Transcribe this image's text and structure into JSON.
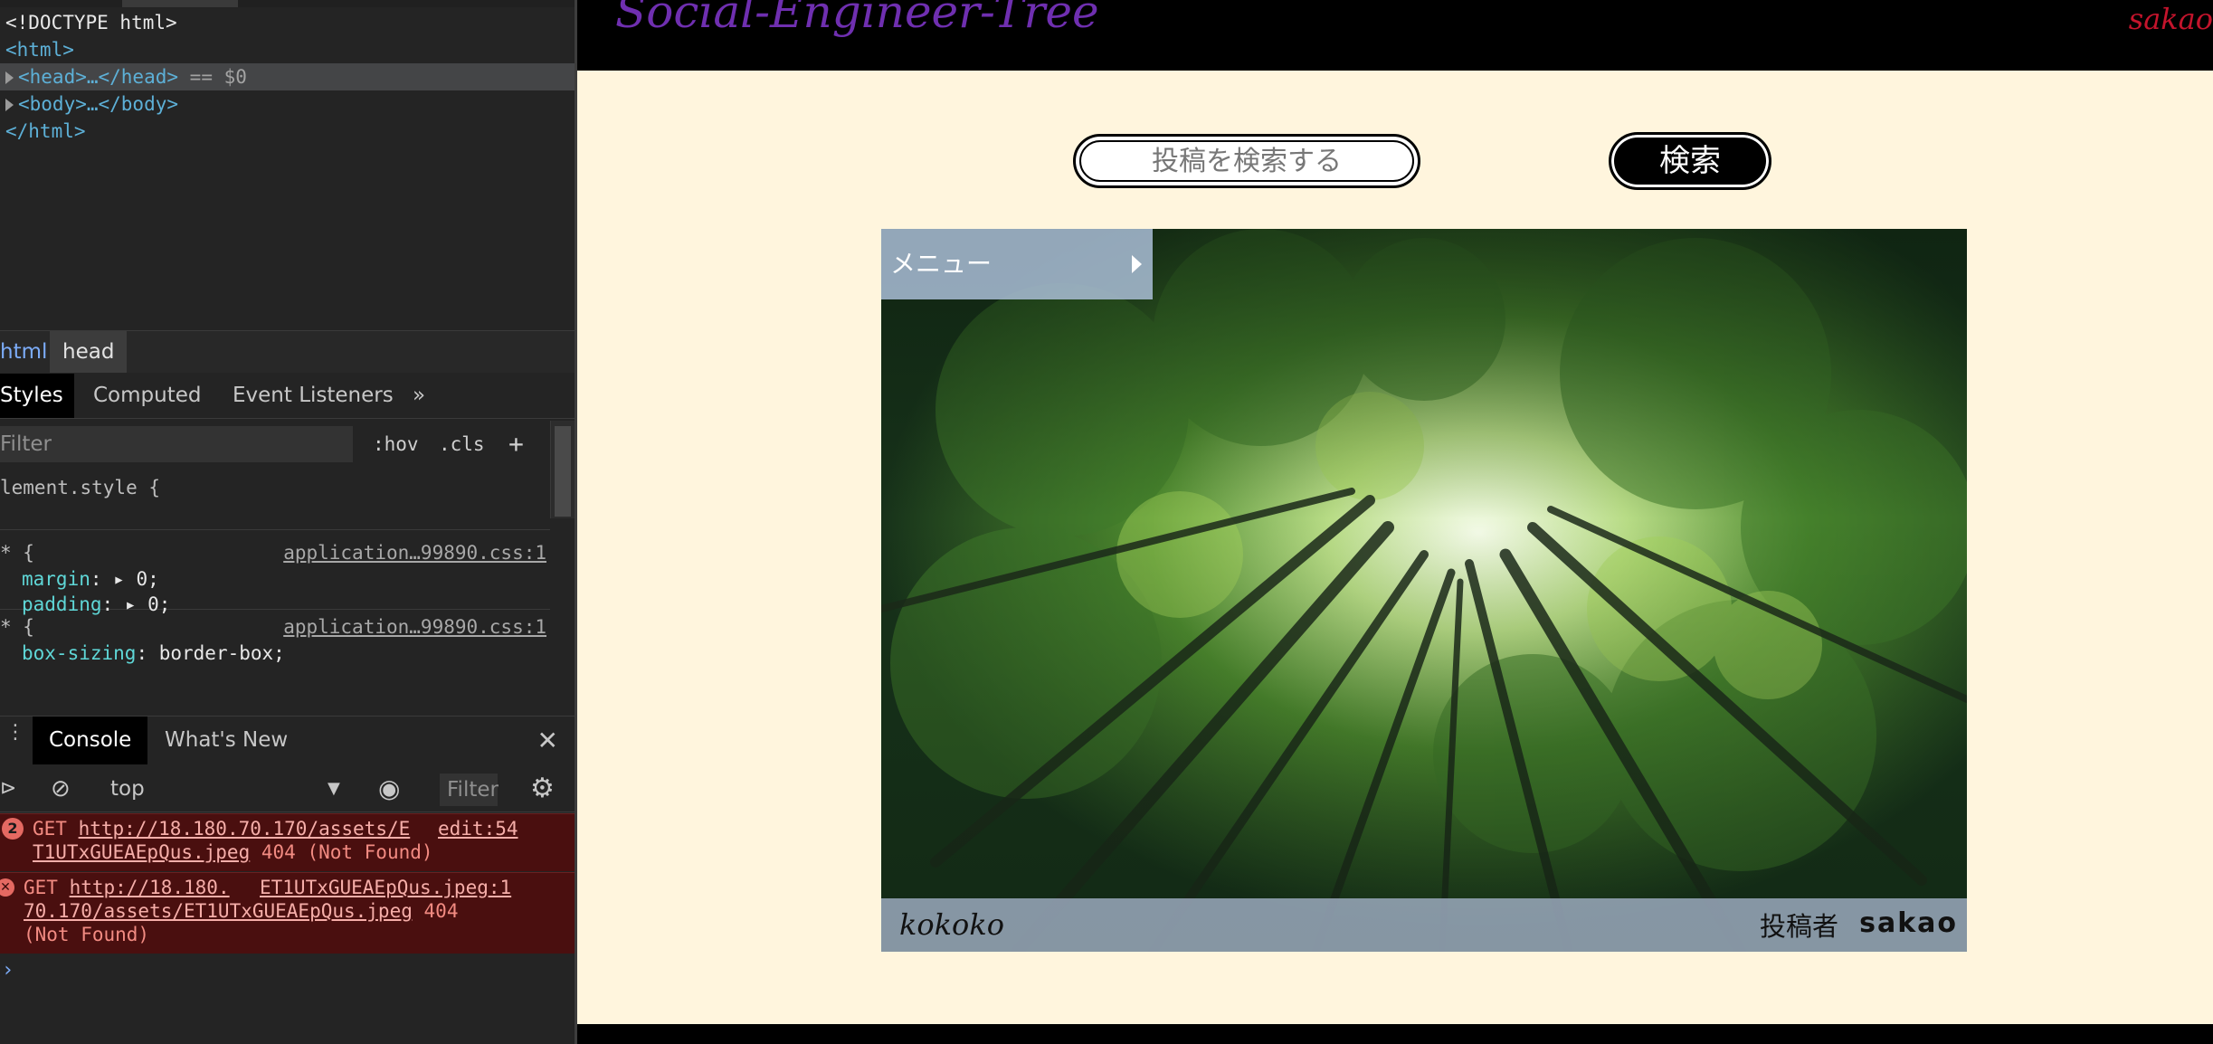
{
  "devtools": {
    "dom": {
      "doctype": "<!DOCTYPE html>",
      "html_open": "<html>",
      "head_line": "<head>…</head>",
      "selected_marker": "== $0",
      "body_line": "<body>…</body>",
      "html_close": "</html>"
    },
    "breadcrumbs": [
      "html",
      "head"
    ],
    "styles_tabs": [
      "Styles",
      "Computed",
      "Event Listeners",
      "»"
    ],
    "filter": {
      "placeholder": "Filter",
      "hov": ":hov",
      "cls": ".cls",
      "add": "+"
    },
    "rules": [
      {
        "selector": "lement.style {",
        "source": "",
        "props": []
      },
      {
        "selector": "* {",
        "source": "application…99890.css:1",
        "props": [
          {
            "name": "margin",
            "value": "▸ 0;"
          },
          {
            "name": "padding",
            "value": "▸ 0;"
          }
        ]
      },
      {
        "selector": "* {",
        "source": "application…99890.css:1",
        "props": [
          {
            "name": "box-sizing",
            "value": "border-box;"
          }
        ]
      }
    ],
    "console_tabs": [
      "Console",
      "What's New"
    ],
    "console_toolbar": {
      "context": "top",
      "filter_placeholder": "Filter"
    },
    "messages": [
      {
        "count": "2",
        "method": "GET",
        "url_part1": "http://18.180.70.170/assets/E",
        "source": "edit:54",
        "url_part2": "T1UTxGUEAEpQus.jpeg",
        "status": "404 (Not Found)"
      },
      {
        "method": "GET",
        "url_part1": "http://18.180.",
        "source": "ET1UTxGUEAEpQus.jpeg:1",
        "url_part2": "70.170/assets/ET1UTxGUEAEpQus.jpeg",
        "status": "404",
        "status2": "(Not Found)"
      }
    ],
    "prompt": "›"
  },
  "site": {
    "title": "Social-Engineer-Tree",
    "user": "sakao",
    "search": {
      "placeholder": "投稿を検索する",
      "button": "検索"
    },
    "menu_label": "メニュー",
    "post": {
      "title": "kokoko",
      "author_label": "投稿者",
      "author": "sakao"
    }
  },
  "colors": {
    "site_bg": "#fff5dd",
    "header_bg": "#000000",
    "title_purple": "#6f2fb0",
    "user_red": "#c4142c",
    "error_bg": "#4a0f0f"
  }
}
